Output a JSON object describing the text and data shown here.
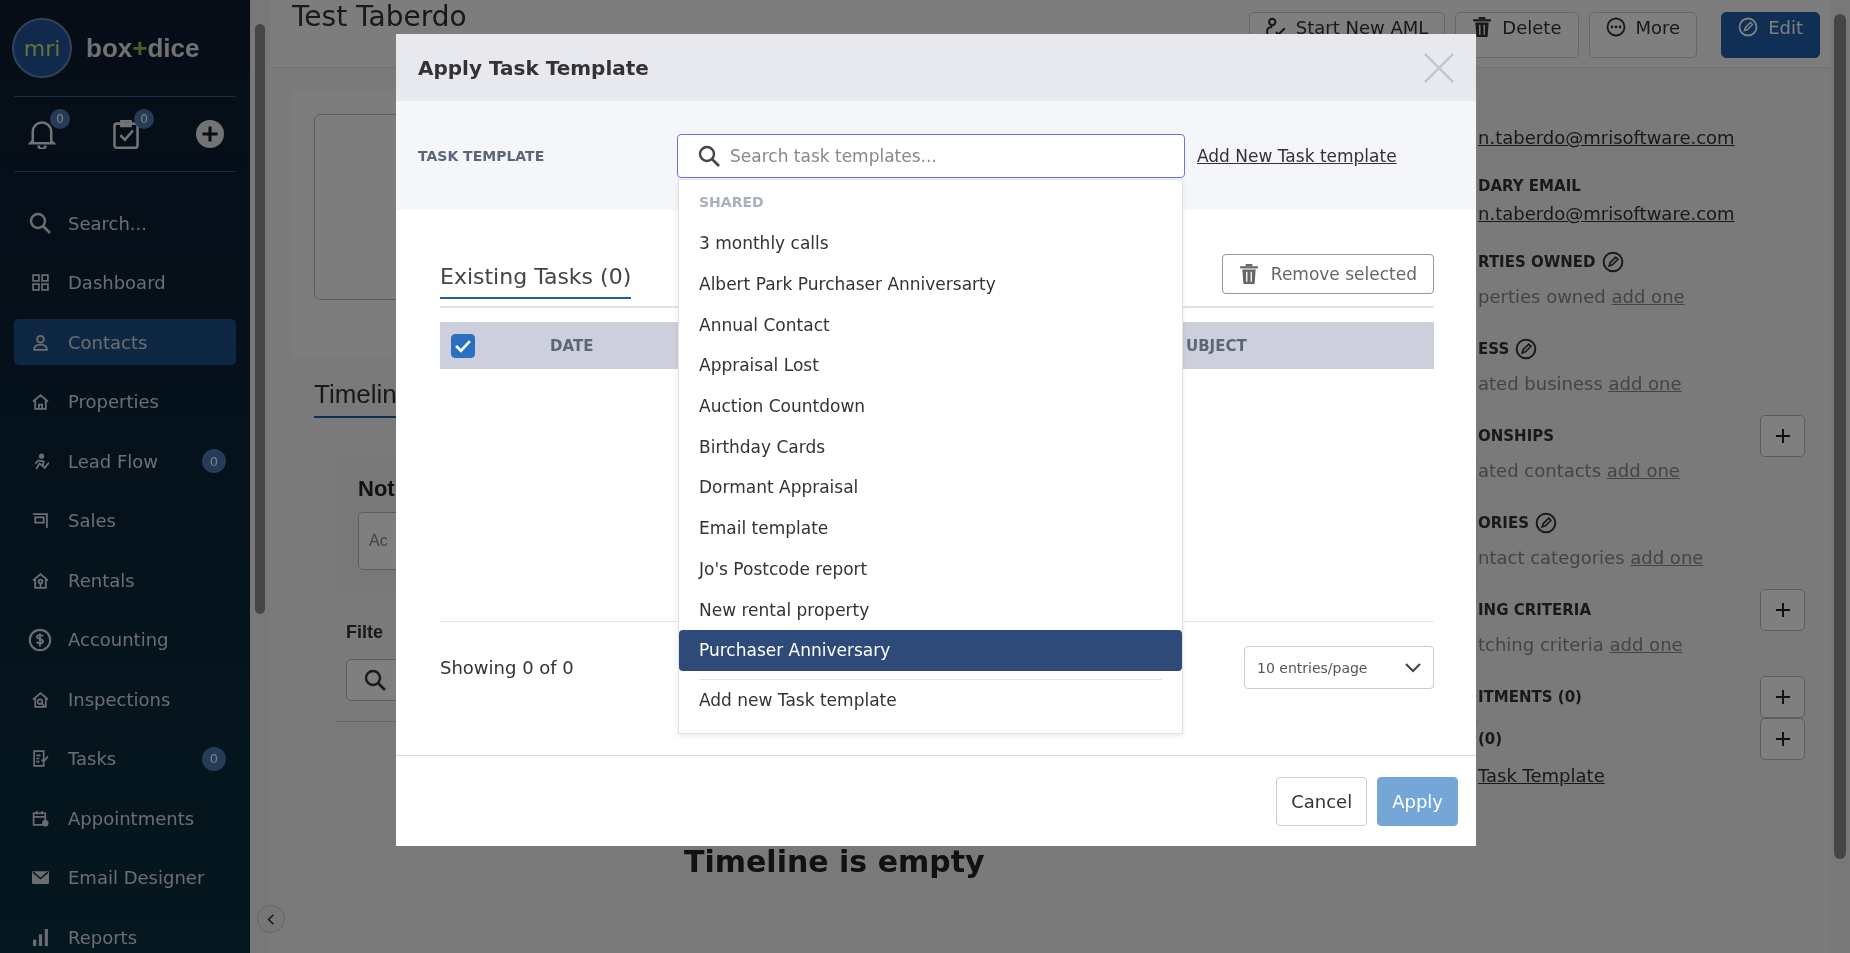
{
  "sidebar": {
    "logo": "mri",
    "brand": [
      "box",
      "+",
      "dice"
    ],
    "quick_actions": [
      {
        "kind": "bell",
        "badge": "0"
      },
      {
        "kind": "tasks",
        "badge": "0"
      },
      {
        "kind": "add"
      }
    ],
    "items": [
      {
        "label": "Search...",
        "selected": false
      },
      {
        "label": "Dashboard",
        "selected": false
      },
      {
        "label": "Contacts",
        "selected": true
      },
      {
        "label": "Properties",
        "selected": false
      },
      {
        "label": "Lead Flow",
        "selected": false,
        "badge": "0"
      },
      {
        "label": "Sales",
        "selected": false
      },
      {
        "label": "Rentals",
        "selected": false
      },
      {
        "label": "Accounting",
        "selected": false
      },
      {
        "label": "Inspections",
        "selected": false
      },
      {
        "label": "Tasks",
        "selected": false,
        "badge": "0"
      },
      {
        "label": "Appointments",
        "selected": false
      },
      {
        "label": "Email Designer",
        "selected": false
      },
      {
        "label": "Reports",
        "selected": false
      }
    ]
  },
  "page": {
    "title": "Test Taberdo",
    "actions": [
      {
        "label": "Start New AML",
        "primary": false
      },
      {
        "label": "Delete",
        "primary": false
      },
      {
        "label": "More",
        "primary": false
      },
      {
        "label": "Edit",
        "primary": true
      }
    ],
    "timeline_tab": "Timelin",
    "notes_title": "Not",
    "notes_placeholder": "Ac",
    "filter_label": "Filte",
    "empty_message": "Timeline is empty",
    "details": [
      {
        "kind": "email",
        "text": "n.taberdo@mrisoftware.com"
      },
      {
        "kind": "heading",
        "text": "DARY EMAIL",
        "editable": false,
        "addable": false
      },
      {
        "kind": "email",
        "text": "n.taberdo@mrisoftware.com"
      },
      {
        "kind": "heading",
        "text": "RTIES OWNED",
        "editable": true,
        "addable": false
      },
      {
        "kind": "empty",
        "text": "perties owned",
        "link": "add one"
      },
      {
        "kind": "heading",
        "text": "ESS",
        "editable": true,
        "addable": false
      },
      {
        "kind": "empty",
        "text": "ated business",
        "link": "add one"
      },
      {
        "kind": "heading",
        "text": "ONSHIPS",
        "editable": false,
        "addable": true
      },
      {
        "kind": "empty",
        "text": "ated contacts",
        "link": "add one"
      },
      {
        "kind": "heading",
        "text": "ORIES",
        "editable": true,
        "addable": false
      },
      {
        "kind": "empty",
        "text": "ntact categories",
        "link": "add one"
      },
      {
        "kind": "heading",
        "text": "ING CRITERIA",
        "editable": false,
        "addable": true
      },
      {
        "kind": "empty",
        "text": "tching criteria",
        "link": "add one"
      },
      {
        "kind": "heading",
        "text": "ITMENTS (0)",
        "editable": false,
        "addable": true
      },
      {
        "kind": "heading",
        "text": "(0)",
        "editable": false,
        "addable": true
      },
      {
        "kind": "link",
        "text": "Task Template"
      }
    ]
  },
  "modal": {
    "title": "Apply Task Template",
    "field_label": "TASK TEMPLATE",
    "search": {
      "placeholder": "Search task templates..."
    },
    "add_link": "Add New Task template",
    "tab": {
      "label": "Existing Tasks (0)",
      "selected": true
    },
    "remove_button": "Remove selected",
    "table": {
      "select_all": {
        "checked": true
      },
      "columns": [
        "DATE",
        "UBJECT"
      ]
    },
    "summary": "Showing 0 of 0",
    "page_size": "10 entries/page",
    "buttons": [
      {
        "label": "Cancel",
        "primary": false
      },
      {
        "label": "Apply",
        "primary": true
      }
    ],
    "dropdown": {
      "group": "SHARED",
      "options": [
        {
          "label": "3 monthly calls",
          "selected": false
        },
        {
          "label": "Albert Park Purchaser Anniversarty",
          "selected": false
        },
        {
          "label": "Annual Contact",
          "selected": false
        },
        {
          "label": "Appraisal Lost",
          "selected": false
        },
        {
          "label": "Auction Countdown",
          "selected": false
        },
        {
          "label": "Birthday Cards",
          "selected": false
        },
        {
          "label": "Dormant Appraisal",
          "selected": false
        },
        {
          "label": "Email template",
          "selected": false
        },
        {
          "label": "Jo's Postcode report",
          "selected": false
        },
        {
          "label": "New rental property",
          "selected": false
        },
        {
          "label": "Purchaser Anniversary",
          "selected": true
        }
      ],
      "footer": "Add new Task template"
    }
  }
}
